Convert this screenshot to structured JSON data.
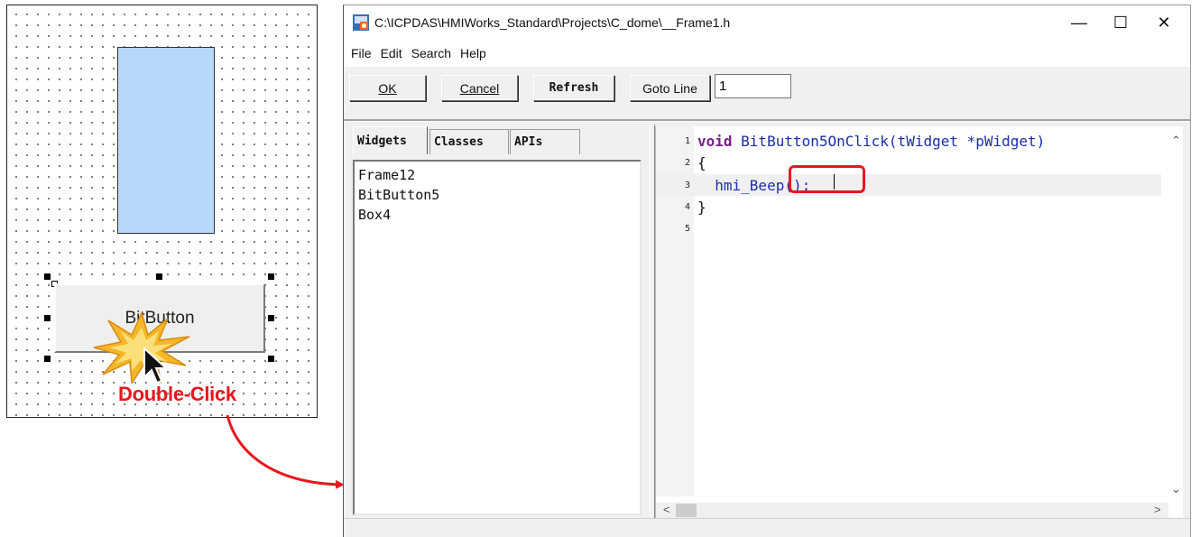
{
  "canvas": {
    "bitbutton_label": "BitButton",
    "annotation": "Double-Click"
  },
  "window": {
    "title": "C:\\ICPDAS\\HMIWorks_Standard\\Projects\\C_dome\\__Frame1.h",
    "controls": {
      "minimize": "—",
      "maximize": "☐",
      "close": "✕"
    }
  },
  "menu": [
    "File",
    "Edit",
    "Search",
    "Help"
  ],
  "toolbar": {
    "ok_label": "OK",
    "cancel_label": "Cancel",
    "refresh_label": "Refresh",
    "goto_label": "Goto Line",
    "goto_value": "1"
  },
  "tabs": [
    "Widgets",
    "Classes",
    "APIs"
  ],
  "widgets_list": [
    "Frame12",
    "BitButton5",
    "Box4"
  ],
  "code": {
    "line_numbers": [
      "1",
      "2",
      "3",
      "4",
      "5"
    ],
    "lines": [
      {
        "keyword": "void",
        "text": " BitButton5OnClick(tWidget *pWidget)"
      },
      {
        "keyword": "",
        "text": "{"
      },
      {
        "keyword": "",
        "text": "  hmi_Beep();"
      },
      {
        "keyword": "",
        "text": "}"
      },
      {
        "keyword": "",
        "text": ""
      }
    ]
  },
  "colors": {
    "annotation_red": "#e8171c",
    "rect_fill": "#b7d8fb",
    "keyword": "#7a1f8c",
    "code_text": "#1c2ea8"
  }
}
